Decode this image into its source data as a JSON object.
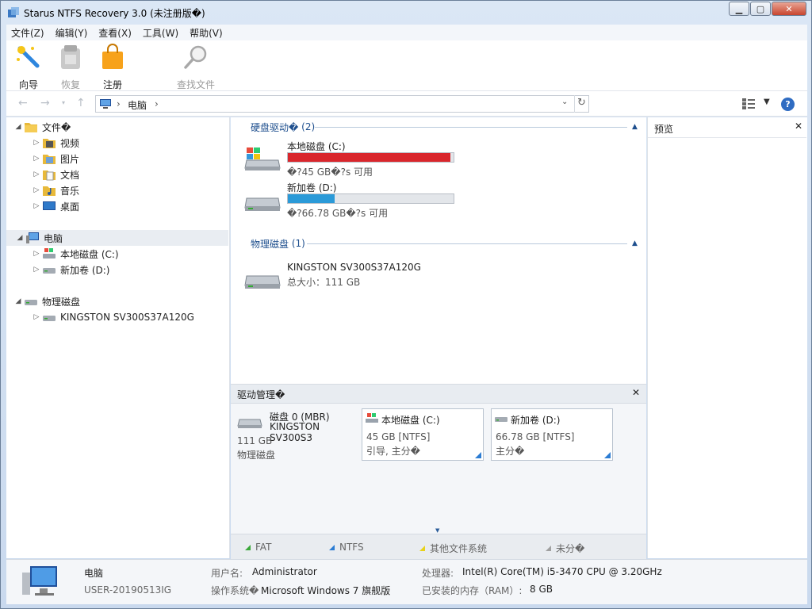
{
  "window": {
    "title": "Starus NTFS Recovery 3.0 (未注册版�)"
  },
  "menu": [
    "文件(Z)",
    "编辑(Y)",
    "查看(X)",
    "工具(W)",
    "帮助(V)"
  ],
  "toolbar": {
    "wizard": "向导",
    "recover": "恢复",
    "register": "注册",
    "find": "查找文件"
  },
  "address": {
    "path": "电脑"
  },
  "tree": {
    "files": "文件�",
    "videos": "视频",
    "pictures": "图片",
    "documents": "文档",
    "music": "音乐",
    "desktop": "桌面",
    "computer": "电脑",
    "drive_c": "本地磁盘 (C:)",
    "drive_d": "新加卷 (D:)",
    "physical": "物理磁盘",
    "kingston": "KINGSTON SV300S37A120G"
  },
  "main": {
    "hdd_header": "硬盘驱动�",
    "hdd_count": "(2)",
    "drive_c": {
      "name": "本地磁盘 (C:)",
      "free": "�?45 GB�?s 可用",
      "used_fraction": 0.98,
      "bar_color": "#d9262c"
    },
    "drive_d": {
      "name": "新加卷 (D:)",
      "free": "�?66.78 GB�?s 可用",
      "used_fraction": 0.28,
      "bar_color": "#2b9ad8"
    },
    "phys_header": "物理磁盘",
    "phys_count": "(1)",
    "kingston": {
      "name": "KINGSTON SV300S37A120G",
      "size": "总大小：111 GB"
    }
  },
  "preview": {
    "title": "预览"
  },
  "drive_mgmt": {
    "title": "驱动管理�",
    "disk": {
      "name1": "磁盘 0 (MBR)",
      "name2": "KINGSTON SV300S3",
      "size": "111 GB",
      "type": "物理磁盘"
    },
    "part_c": {
      "name": "本地磁盘 (C:)",
      "l1": "45 GB [NTFS]",
      "l2": "引导, 主分�"
    },
    "part_d": {
      "name": "新加卷 (D:)",
      "l1": "66.78 GB [NTFS]",
      "l2": "主分�"
    },
    "legend": {
      "fat": "FAT",
      "ntfs": "NTFS",
      "other": "其他文件系统",
      "unalloc": "未分�"
    },
    "legend_colors": {
      "fat": "#3aa83a",
      "ntfs": "#2b7cd3",
      "other": "#e8d21a",
      "unalloc": "#a0a0a0"
    }
  },
  "status": {
    "pc_name": "电脑",
    "host": "USER-20190513IG",
    "user_label": "用户名:",
    "user_value": "Administrator",
    "os_label": "操作系统�",
    "os_value": "Microsoft Windows 7 旗舰版",
    "cpu_label": "处理器:",
    "cpu_value": "Intel(R) Core(TM) i5-3470 CPU @ 3.20GHz",
    "ram_label": "已安装的内存（RAM）:",
    "ram_value": "8 GB"
  }
}
